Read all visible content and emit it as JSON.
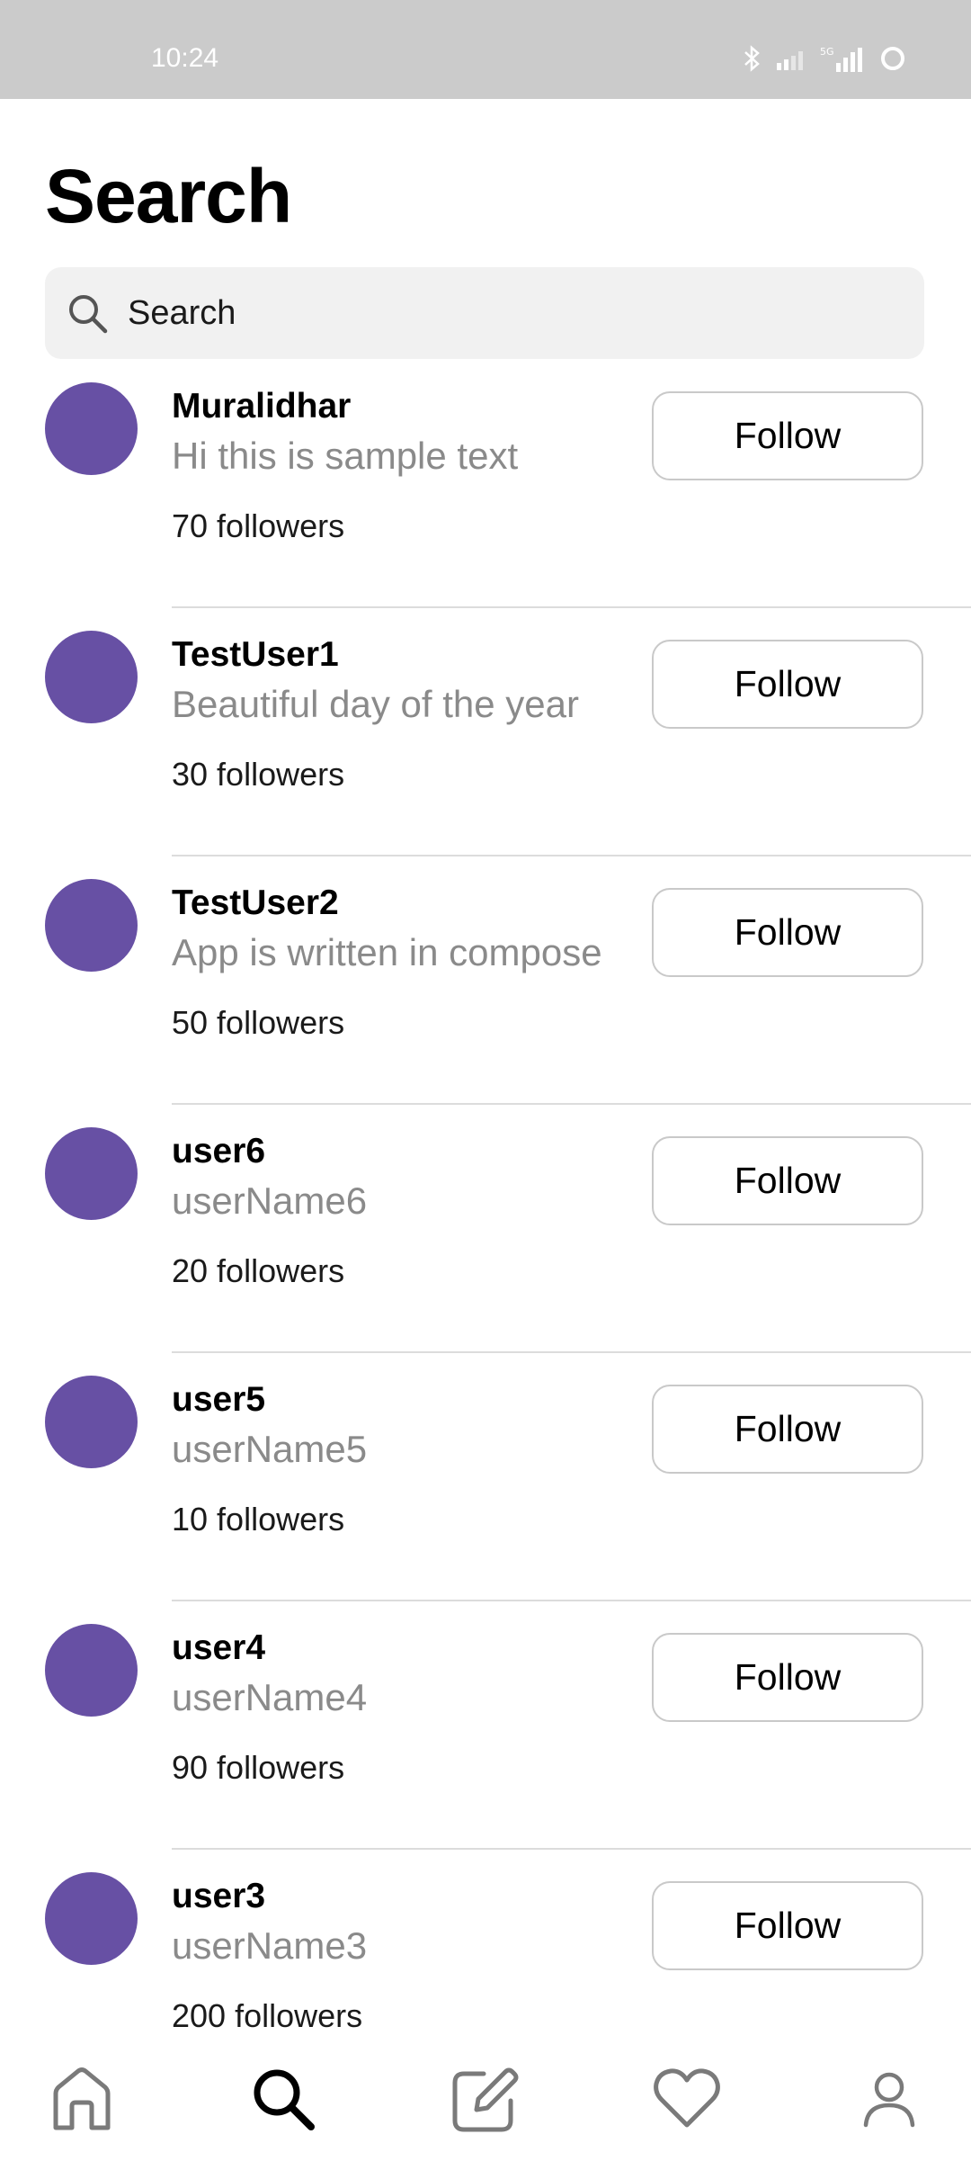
{
  "status_bar": {
    "time": "10:24",
    "icons": [
      "bluetooth-icon",
      "signal-icon",
      "5g-signal-icon",
      "battery-icon"
    ]
  },
  "page": {
    "title": "Search"
  },
  "search": {
    "placeholder": "Search",
    "icon": "search-icon"
  },
  "users": [
    {
      "name": "Muralidhar",
      "bio": "Hi this is sample text",
      "followers": "70 followers",
      "button": "Follow"
    },
    {
      "name": "TestUser1",
      "bio": "Beautiful day of the year",
      "followers": "30 followers",
      "button": "Follow"
    },
    {
      "name": "TestUser2",
      "bio": "App is written in compose",
      "followers": "50 followers",
      "button": "Follow"
    },
    {
      "name": "user6",
      "bio": "userName6",
      "followers": "20 followers",
      "button": "Follow"
    },
    {
      "name": "user5",
      "bio": "userName5",
      "followers": "10 followers",
      "button": "Follow"
    },
    {
      "name": "user4",
      "bio": "userName4",
      "followers": "90 followers",
      "button": "Follow"
    },
    {
      "name": "user3",
      "bio": "userName3",
      "followers": "200 followers",
      "button": "Follow"
    }
  ],
  "bottom_nav": {
    "items": [
      "home-icon",
      "search-icon",
      "edit-icon",
      "heart-icon",
      "profile-icon"
    ],
    "active": "search-icon"
  },
  "colors": {
    "avatar": "#6750a4",
    "status_bar": "#cbcbcb",
    "search_bg": "#f1f1f1",
    "bio_text": "#8a8a8a",
    "divider": "#dcdcdc"
  }
}
